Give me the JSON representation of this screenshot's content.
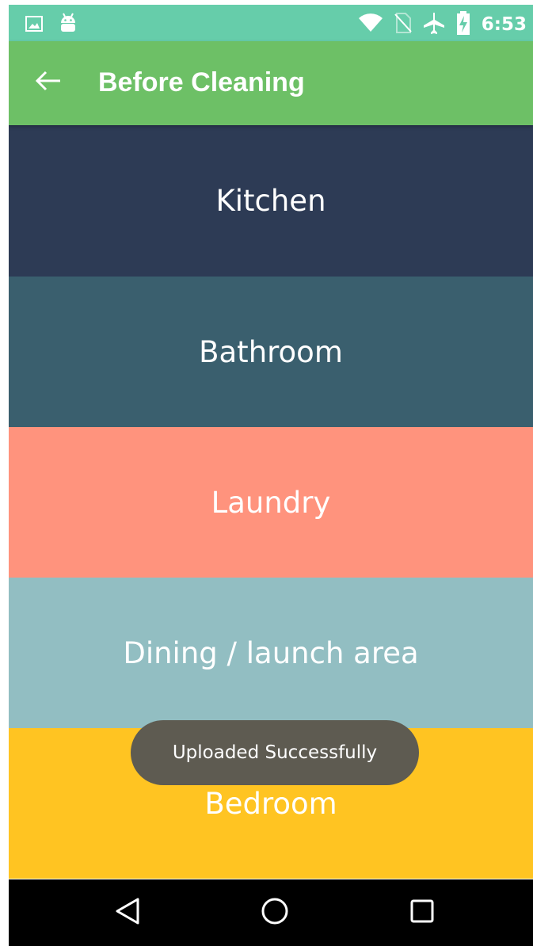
{
  "status_bar": {
    "time": "6:53",
    "icons": [
      "image-icon",
      "android-icon",
      "wifi-icon",
      "no-sim-icon",
      "airplane-icon",
      "battery-charging-icon"
    ],
    "background": "#66CDAA"
  },
  "app_bar": {
    "title": "Before Cleaning",
    "back_icon": "arrow-back-icon",
    "background": "#6DC066"
  },
  "rooms": [
    {
      "label": "Kitchen",
      "color": "#2D3B55"
    },
    {
      "label": "Bathroom",
      "color": "#3A5F6E"
    },
    {
      "label": "Laundry",
      "color": "#FF937D"
    },
    {
      "label": "Dining / launch area",
      "color": "#92BEC2"
    },
    {
      "label": "Bedroom",
      "color": "#FFC422"
    }
  ],
  "toast": {
    "message": "Uploaded Successfully"
  },
  "nav_bar": {
    "buttons": [
      "back-triangle-icon",
      "home-circle-icon",
      "recents-square-icon"
    ]
  }
}
